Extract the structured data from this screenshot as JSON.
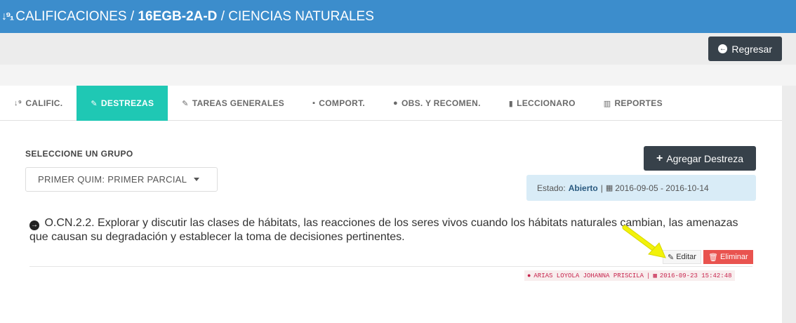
{
  "header": {
    "section": "CALIFICACIONES",
    "separator1": " / ",
    "course": "16EGB-2A-D",
    "separator2": " / ",
    "subject": "CIENCIAS NATURALES"
  },
  "toolbar": {
    "back_label": "Regresar"
  },
  "tabs": [
    {
      "label": "CALIFIC.",
      "icon": "sort-numeric-icon"
    },
    {
      "label": "DESTREZAS",
      "icon": "edit-icon",
      "active": true
    },
    {
      "label": "TAREAS GENERALES",
      "icon": "edit-icon"
    },
    {
      "label": "COMPORT.",
      "icon": "comment-icon"
    },
    {
      "label": "OBS. Y RECOMEN.",
      "icon": "comments-icon"
    },
    {
      "label": "LECCIONARO",
      "icon": "book-icon"
    },
    {
      "label": "REPORTES",
      "icon": "bar-chart-icon"
    }
  ],
  "group": {
    "label": "SELECCIONE UN GRUPO",
    "selected": "PRIMER QUIM: PRIMER PARCIAL"
  },
  "actions": {
    "add_label": "Agregar Destreza"
  },
  "status": {
    "label": "Estado:",
    "value": "Abierto",
    "separator": "|",
    "date_range": "2016-09-05 - 2016-10-14"
  },
  "destreza": {
    "text": "O.CN.2.2. Explorar y discutir las clases de hábitats, las reacciones de los seres vivos cuando los hábitats naturales cambian, las amenazas que causan su degradación y establecer la toma de decisiones pertinentes.",
    "edit_label": "Editar",
    "delete_label": "Eliminar",
    "author": "ARIAS LOYOLA JOHANNA PRISCILA",
    "author_separator": "|",
    "timestamp": "2016-09-23 15:42:48"
  },
  "colors": {
    "header_bg": "#3c8dcc",
    "tab_active": "#1fc8b4",
    "dark_button": "#37414a",
    "danger": "#e9534f",
    "status_bg": "#d9ecf7",
    "annotation_arrow": "#f2f20a"
  }
}
